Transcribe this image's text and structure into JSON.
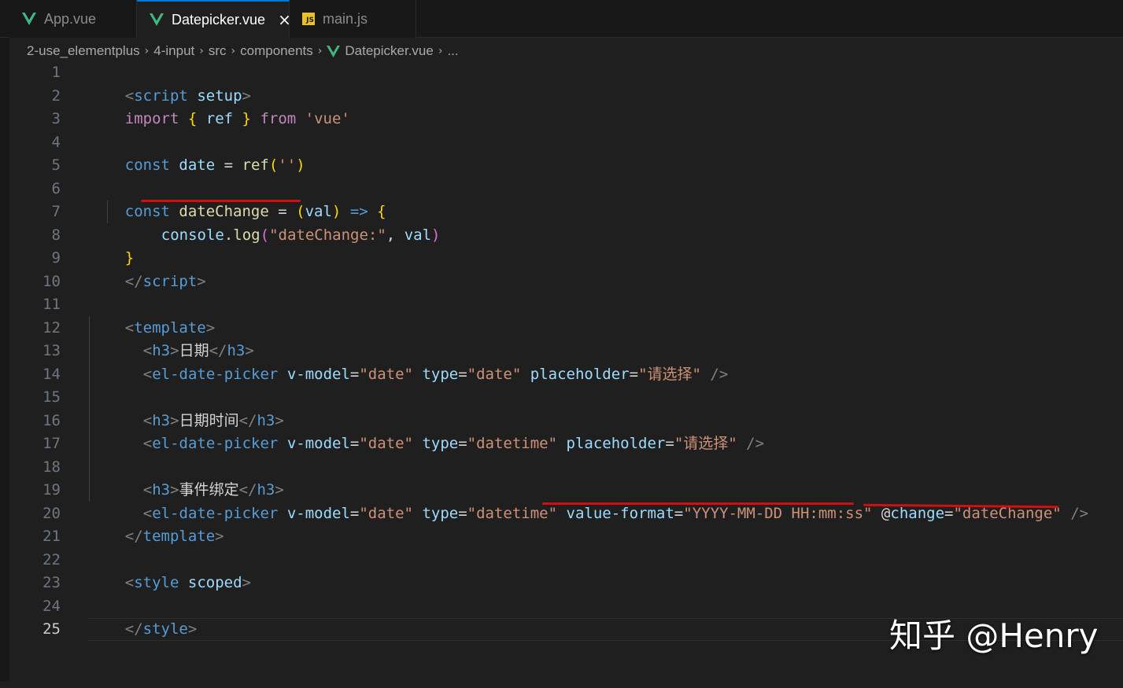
{
  "tabs": [
    {
      "label": "App.vue",
      "icon": "vue-icon",
      "active": false
    },
    {
      "label": "Datepicker.vue",
      "icon": "vue-icon",
      "active": true
    },
    {
      "label": "main.js",
      "icon": "js-icon",
      "active": false
    }
  ],
  "js_badge": "JS",
  "breadcrumb": [
    "2-use_elementplus",
    "4-input",
    "src",
    "components",
    "Datepicker.vue",
    "..."
  ],
  "code": {
    "l1": [
      "<",
      "script",
      " ",
      "setup",
      ">"
    ],
    "l2": [
      "import",
      " ",
      "{",
      " ",
      "ref",
      " ",
      "}",
      " ",
      "from",
      " ",
      "'vue'"
    ],
    "l4": [
      "const",
      " ",
      "date",
      " = ",
      "ref",
      "(",
      "''",
      ")"
    ],
    "l6": [
      "const",
      " ",
      "dateChange",
      " = ",
      "(",
      "val",
      ")",
      " ",
      "=>",
      " ",
      "{"
    ],
    "l7": [
      "console",
      ".",
      "log",
      "(",
      "\"dateChange:\"",
      ", ",
      "val",
      ")"
    ],
    "l8": [
      "}"
    ],
    "l9": [
      "</",
      "script",
      ">"
    ],
    "l11": [
      "<",
      "template",
      ">"
    ],
    "l12": [
      "<",
      "h3",
      ">",
      "日期",
      "</",
      "h3",
      ">"
    ],
    "l13": [
      "<",
      "el-date-picker",
      " ",
      "v-model",
      "=",
      "\"date\"",
      " ",
      "type",
      "=",
      "\"date\"",
      " ",
      "placeholder",
      "=",
      "\"请选择\"",
      " />"
    ],
    "l15": [
      "<",
      "h3",
      ">",
      "日期时间",
      "</",
      "h3",
      ">"
    ],
    "l16": [
      "<",
      "el-date-picker",
      " ",
      "v-model",
      "=",
      "\"date\"",
      " ",
      "type",
      "=",
      "\"datetime\"",
      " ",
      "placeholder",
      "=",
      "\"请选择\"",
      " />"
    ],
    "l18": [
      "<",
      "h3",
      ">",
      "事件绑定",
      "</",
      "h3",
      ">"
    ],
    "l19": [
      "<",
      "el-date-picker",
      " ",
      "v-model",
      "=",
      "\"date\"",
      " ",
      "type",
      "=",
      "\"datetime\"",
      " ",
      "value-format",
      "=",
      "\"YYYY-MM-DD HH:mm:ss\"",
      " ",
      "@",
      "change",
      "=",
      "\"dateChange\"",
      " />"
    ],
    "l20": [
      "</",
      "template",
      ">"
    ],
    "l22": [
      "<",
      "style",
      " ",
      "scoped",
      ">"
    ],
    "l24": [
      "</",
      "style",
      ">"
    ]
  },
  "line_numbers": [
    "1",
    "2",
    "3",
    "4",
    "5",
    "6",
    "7",
    "8",
    "9",
    "10",
    "11",
    "12",
    "13",
    "14",
    "15",
    "16",
    "17",
    "18",
    "19",
    "20",
    "21",
    "22",
    "23",
    "24",
    "25"
  ],
  "current_line": 25,
  "watermark": "知乎 @Henry",
  "colors": {
    "underline": "#d10f0f",
    "accent": "#0078d4",
    "vue_green": "#41b883",
    "js_yellow": "#e8c22c"
  }
}
